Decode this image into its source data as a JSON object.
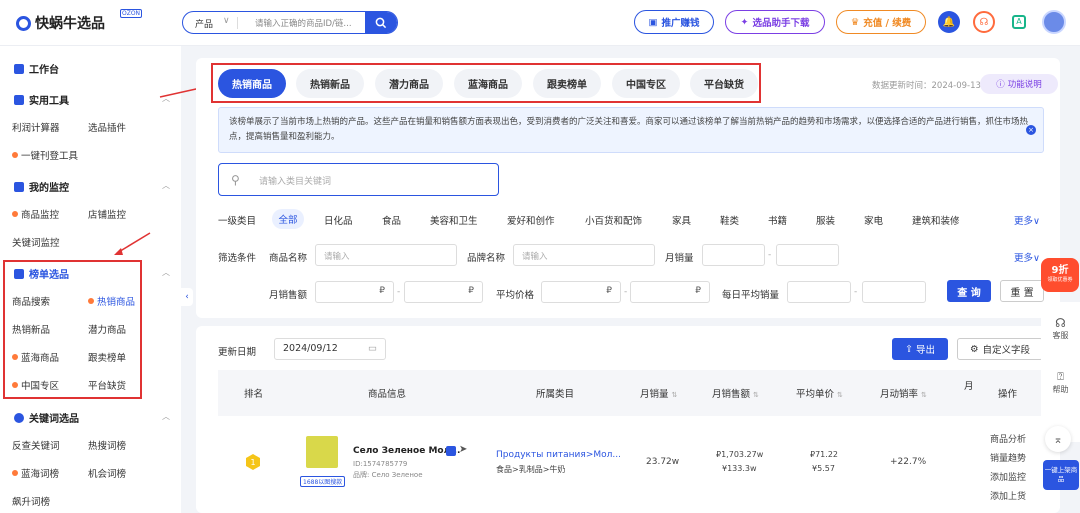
{
  "brand": {
    "name": "快蜗牛选品",
    "badge": "OZON"
  },
  "header": {
    "search": {
      "category": "产品",
      "placeholder": "请输入正确的商品ID/链..."
    },
    "promo_label": "推广赚钱",
    "download_label": "选品助手下载",
    "vip_label": "充值 / 续费"
  },
  "sidebar": {
    "workbench": "工作台",
    "tools": {
      "title": "实用工具",
      "items": [
        "利润计算器",
        "选品插件",
        "一键刊登工具"
      ]
    },
    "monitor": {
      "title": "我的监控",
      "items": [
        "商品监控",
        "店铺监控",
        "关键词监控"
      ]
    },
    "rank": {
      "title": "榜单选品",
      "items": [
        "商品搜索",
        "热销商品",
        "热销新品",
        "潜力商品",
        "蓝海商品",
        "跟卖榜单",
        "中国专区",
        "平台缺货"
      ]
    },
    "keyword": {
      "title": "关键词选品",
      "items": [
        "反查关键词",
        "热搜词榜",
        "蓝海词榜",
        "机会词榜",
        "飙升词榜"
      ]
    }
  },
  "tabs": [
    "热销商品",
    "热销新品",
    "潜力商品",
    "蓝海商品",
    "跟卖榜单",
    "中国专区",
    "平台缺货"
  ],
  "update_time": "数据更新时间：2024-09-13",
  "help_label": "功能说明",
  "info": "该榜单展示了当前市场上热销的产品。这些产品在销量和销售额方面表现出色，受到消费者的广泛关注和喜爱。商家可以通过该榜单了解当前热销产品的趋势和市场需求，以便选择合适的产品进行销售，抓住市场热点，提高销售量和盈利能力。",
  "category_search_placeholder": "请输入类目关键词",
  "filters": {
    "category_label": "一级类目",
    "categories": [
      "全部",
      "日化品",
      "食品",
      "美容和卫生",
      "爱好和创作",
      "小百货和配饰",
      "家具",
      "鞋类",
      "书籍",
      "服装",
      "家电",
      "建筑和装修"
    ],
    "more": "更多",
    "conditions_label": "筛选条件",
    "product_name": "商品名称",
    "brand_name": "品牌名称",
    "monthly_sales": "月销量",
    "monthly_revenue": "月销售额",
    "avg_price": "平均价格",
    "daily_avg_sales": "每日平均销量",
    "input_placeholder": "请输入",
    "rub": "₽",
    "query": "查 询",
    "reset": "重 置"
  },
  "table": {
    "date_label": "更新日期",
    "date_value": "2024/09/12",
    "export": "导出",
    "custom_fields": "自定义字段",
    "headers": [
      "排名",
      "商品信息",
      "所属类目",
      "月销量",
      "月销售额",
      "平均单价",
      "月动销率",
      "月",
      "操作"
    ],
    "row": {
      "rank": "1",
      "name": "Село Зеленое Мол...",
      "id": "ID:1574785779",
      "brand": "品牌: Село Зеленое",
      "tag": "1688以图搜款",
      "category": "Продукты питания>Мол...",
      "category_cn": "食品>乳制品>牛奶",
      "sales": "23.72w",
      "revenue_rub": "₽1,703.27w",
      "revenue_cny": "¥133.3w",
      "price_rub": "₽71.22",
      "price_cny": "¥5.57",
      "turnover": "+22.7%",
      "ops": [
        "商品分析",
        "销量趋势",
        "添加监控",
        "添加上货"
      ]
    }
  },
  "rail": {
    "discount": "9折",
    "discount_sub": "领取优惠券",
    "service": "客服",
    "help": "帮助",
    "listing": "一键上架商品"
  }
}
